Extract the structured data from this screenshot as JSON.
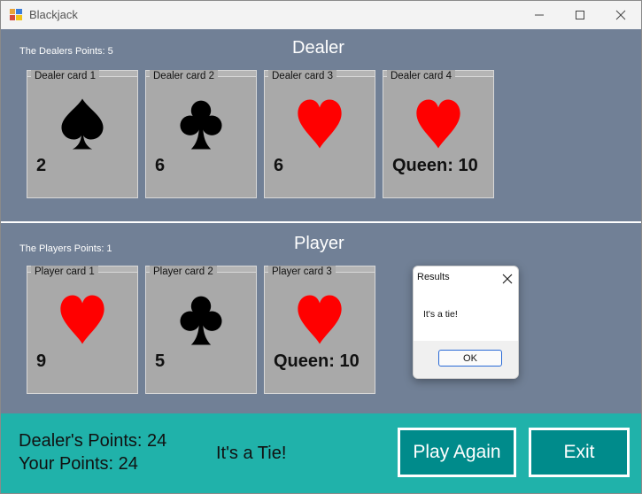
{
  "window": {
    "title": "Blackjack"
  },
  "dealer": {
    "heading": "Dealer",
    "points_label": "The Dealers Points: 5",
    "cards": [
      {
        "title": "Dealer card 1",
        "suit": "spade",
        "value": "2"
      },
      {
        "title": "Dealer card 2",
        "suit": "club",
        "value": "6"
      },
      {
        "title": "Dealer card 3",
        "suit": "heart",
        "value": "6"
      },
      {
        "title": "Dealer card 4",
        "suit": "heart",
        "value": "Queen: 10"
      }
    ]
  },
  "player": {
    "heading": "Player",
    "points_label": "The Players Points: 1",
    "cards": [
      {
        "title": "Player card 1",
        "suit": "heart",
        "value": "9"
      },
      {
        "title": "Player card 2",
        "suit": "club",
        "value": "5"
      },
      {
        "title": "Player card 3",
        "suit": "heart",
        "value": "Queen: 10"
      }
    ]
  },
  "footer": {
    "dealer_points": "Dealer's Points: 24",
    "your_points": "Your Points:  24",
    "result": "It's a Tie!",
    "play_again": "Play Again",
    "exit": "Exit"
  },
  "dialog": {
    "title": "Results",
    "message": "It's a tie!",
    "ok": "OK"
  },
  "colors": {
    "table": "#718096",
    "footer": "#20b2aa",
    "button": "#008b8b",
    "card": "#a9a9a9",
    "heart": "#ff0000",
    "black_suit": "#000000"
  },
  "icons": {
    "spade": "spade-icon",
    "club": "club-icon",
    "heart": "heart-icon"
  }
}
